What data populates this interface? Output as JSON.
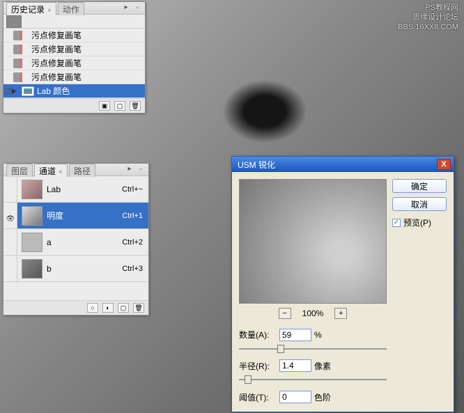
{
  "watermark": {
    "line1": "思缘设计论坛",
    "line2": "BBS.16XX8.COM",
    "corner": "PS教程网"
  },
  "history": {
    "tabs": {
      "active": "历史记录",
      "inactive": "动作"
    },
    "items": [
      {
        "label": "污点修复画笔",
        "icon": "brush"
      },
      {
        "label": "污点修复画笔",
        "icon": "brush"
      },
      {
        "label": "污点修复画笔",
        "icon": "brush"
      },
      {
        "label": "污点修复画笔",
        "icon": "brush"
      },
      {
        "label": "Lab 颜色",
        "icon": "mode",
        "selected": true
      }
    ]
  },
  "channels": {
    "tabs": {
      "t1": "图层",
      "t2": "通道",
      "t3": "路径"
    },
    "rows": [
      {
        "name": "Lab",
        "shortcut": "Ctrl+~",
        "eye": false
      },
      {
        "name": "明度",
        "shortcut": "Ctrl+1",
        "eye": true,
        "selected": true
      },
      {
        "name": "a",
        "shortcut": "Ctrl+2",
        "eye": false
      },
      {
        "name": "b",
        "shortcut": "Ctrl+3",
        "eye": false
      }
    ]
  },
  "usm": {
    "title": "USM 锐化",
    "ok": "确定",
    "cancel": "取消",
    "preview_chk": "预览(P)",
    "zoom": "100%",
    "amount_label": "数量(A):",
    "amount_value": "59",
    "amount_unit": "%",
    "radius_label": "半径(R):",
    "radius_value": "1.4",
    "radius_unit": "像素",
    "thresh_label": "阈值(T):",
    "thresh_value": "0",
    "thresh_unit": "色阶"
  }
}
